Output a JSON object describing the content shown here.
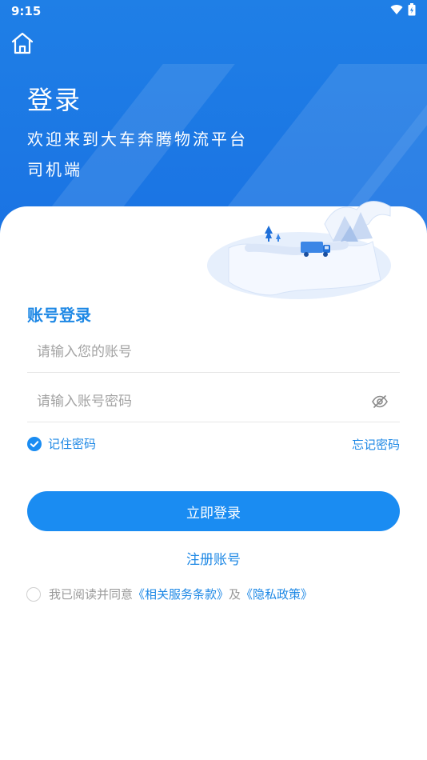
{
  "status_bar": {
    "time": "9:15"
  },
  "header": {
    "title": "登录",
    "subtitle_line1": "欢迎来到大车奔腾物流平台",
    "subtitle_line2": "司机端"
  },
  "login": {
    "section_title": "账号登录",
    "account_placeholder": "请输入您的账号",
    "password_placeholder": "请输入账号密码",
    "remember_label": "记住密码",
    "remember_checked": true,
    "forgot_label": "忘记密码",
    "submit_label": "立即登录",
    "register_label": "注册账号"
  },
  "agreement": {
    "prefix": "我已阅读并同意",
    "terms_link": "《相关服务条款》",
    "conjunction": "及",
    "privacy_link": "《隐私政策》",
    "checked": false
  },
  "colors": {
    "primary": "#1a8cf2",
    "accent_text": "#1e88e5",
    "header_bg": "#1f7fe6"
  },
  "icons": {
    "home": "home-icon",
    "eye": "eye-off-icon",
    "wifi": "wifi-icon",
    "battery": "battery-icon"
  }
}
